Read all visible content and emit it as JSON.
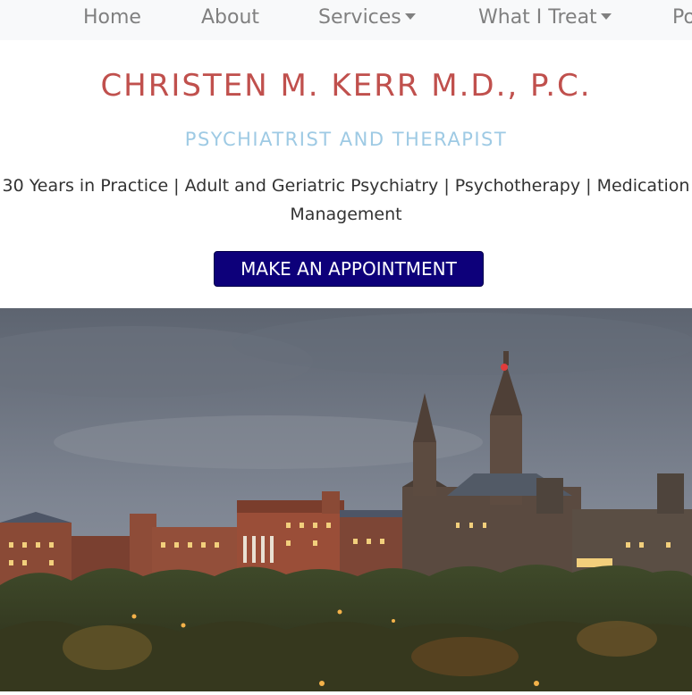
{
  "nav": {
    "items": [
      {
        "label": "Home",
        "dropdown": false
      },
      {
        "label": "About",
        "dropdown": false
      },
      {
        "label": "Services",
        "dropdown": true
      },
      {
        "label": "What I Treat",
        "dropdown": true
      },
      {
        "label": "Po",
        "dropdown": false
      }
    ]
  },
  "header": {
    "title": "CHRISTEN M. KERR M.D., P.C.",
    "subtitle": "PSYCHIATRIST AND THERAPIST",
    "tagline": "30 Years in Practice | Adult and Geriatric Psychiatry | Psychotherapy | Medication Management"
  },
  "cta": {
    "label": "MAKE AN APPOINTMENT"
  },
  "hero": {
    "description_icon": "campus-skyline-image"
  },
  "colors": {
    "title": "#c0504d",
    "subtitle": "#9ecae4",
    "button_bg": "#0d007a",
    "nav_bg": "#f8f9fa",
    "nav_text": "#808080"
  }
}
